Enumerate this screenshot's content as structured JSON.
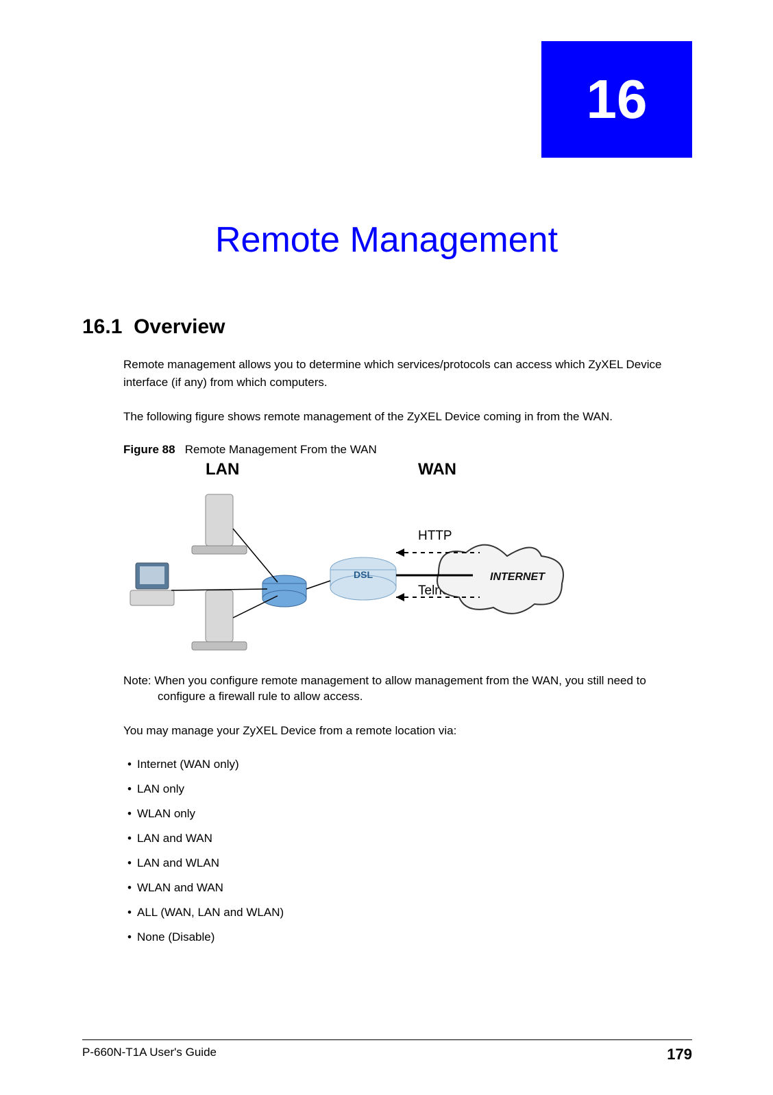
{
  "chapter_number": "16",
  "chapter_title": "Remote Management",
  "section_number": "16.1",
  "section_title": "Overview",
  "para1": "Remote management allows you to determine which services/protocols can access which ZyXEL Device interface (if any) from which computers.",
  "para2": "The following figure shows remote management of the ZyXEL Device coming in from the WAN.",
  "figure_label": "Figure 88",
  "figure_title": "Remote Management From the WAN",
  "diagram": {
    "lan_label": "LAN",
    "wan_label": "WAN",
    "http_label": "HTTP",
    "telnet_label": "Telnet",
    "internet_label": "INTERNET",
    "dsl_label": "DSL"
  },
  "note": "Note: When you configure remote management to allow management from the WAN, you still need to configure a firewall rule to allow access.",
  "para3": "You may manage your ZyXEL Device from a remote location via:",
  "list": [
    "Internet (WAN only)",
    "LAN only",
    "WLAN only",
    "LAN and WAN",
    "LAN and WLAN",
    "WLAN and WAN",
    "ALL (WAN, LAN and WLAN)",
    "None (Disable)"
  ],
  "footer_guide": "P-660N-T1A User's Guide",
  "page_number": "179"
}
